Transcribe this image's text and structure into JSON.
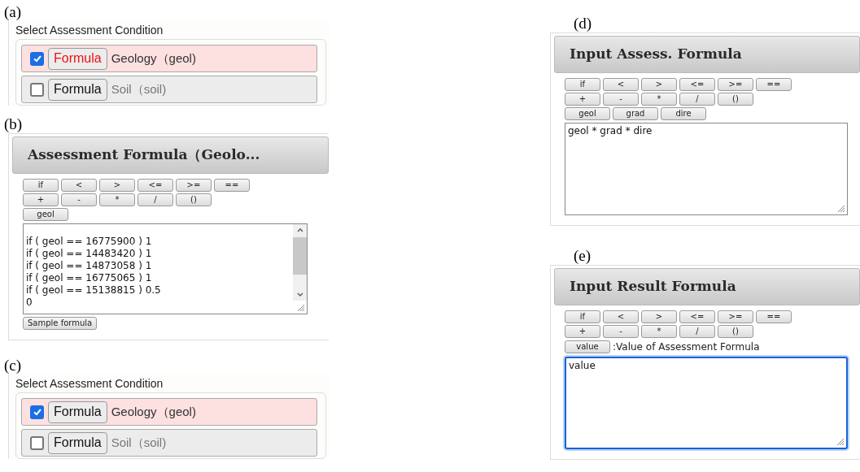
{
  "left": [
    {
      "kind": "condition",
      "label": "(a)",
      "title": "Select Assessment Condition",
      "conditions": [
        {
          "checked": true,
          "button": {
            "label": "Formula",
            "highlighted": true
          },
          "name": "Geology（geol)"
        },
        {
          "checked": false,
          "button": {
            "label": "Formula",
            "highlighted": false
          },
          "name": "Soil（soil)"
        }
      ]
    },
    {
      "kind": "formula",
      "label": "(b)",
      "title": "Assessment Formula（Geolo...",
      "operator_rows": [
        [
          "if",
          "<",
          ">",
          "<=",
          ">=",
          "=="
        ],
        [
          "+",
          "-",
          "*",
          "/",
          "()"
        ]
      ],
      "variables": [
        "geol"
      ],
      "formula": {
        "lines": [
          "if ( geol == 16775900 ) 1",
          "if ( geol == 14483420 ) 1",
          "if ( geol == 14873058 ) 1",
          "if ( geol == 16775065 ) 1",
          "if ( geol == 15138815 ) 0.5",
          "0"
        ],
        "focused": false
      },
      "sample_button": "Sample formula"
    },
    {
      "kind": "condition",
      "label": "(c)",
      "title": "Select Assessment Condition",
      "conditions": [
        {
          "checked": true,
          "button": {
            "label": "Formula",
            "highlighted": false
          },
          "name": "Geology（geol)"
        },
        {
          "checked": false,
          "button": {
            "label": "Formula",
            "highlighted": false
          },
          "name": "Soil（soil)"
        }
      ]
    }
  ],
  "right": [
    {
      "kind": "formula",
      "label": "(d)",
      "title": "Input Assess. Formula",
      "operator_rows": [
        [
          "if",
          "<",
          ">",
          "<=",
          ">=",
          "=="
        ],
        [
          "+",
          "-",
          "*",
          "/",
          "()"
        ]
      ],
      "variables": [
        "geol",
        "grad",
        "dire"
      ],
      "formula": {
        "lines": [
          "geol * grad * dire"
        ],
        "focused": false
      }
    },
    {
      "kind": "formula",
      "label": "(e)",
      "title": "Input Result Formula",
      "operator_rows": [
        [
          "if",
          "<",
          ">",
          "<=",
          ">=",
          "=="
        ],
        [
          "+",
          "-",
          "*",
          "/",
          "()"
        ]
      ],
      "variables": [
        "value"
      ],
      "variable_note": ":Value of Assessment Formula",
      "formula": {
        "lines": [
          "value"
        ],
        "focused": true
      }
    }
  ]
}
